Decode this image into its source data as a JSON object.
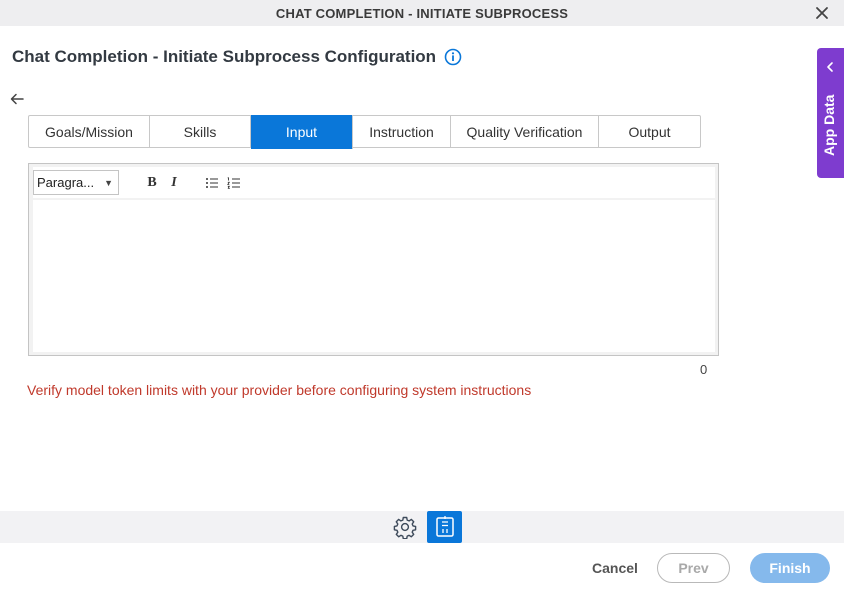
{
  "window": {
    "title": "CHAT COMPLETION - INITIATE SUBPROCESS",
    "close_icon": "close-icon"
  },
  "page": {
    "title": "Chat Completion - Initiate Subprocess Configuration",
    "info_icon": "info-icon",
    "back_icon": "arrow-left-icon"
  },
  "tabs": [
    {
      "label": "Goals/Mission",
      "active": false
    },
    {
      "label": "Skills",
      "active": false
    },
    {
      "label": "Input",
      "active": true
    },
    {
      "label": "Instruction",
      "active": false
    },
    {
      "label": "Quality Verification",
      "active": false
    },
    {
      "label": "Output",
      "active": false
    }
  ],
  "editor": {
    "format_value": "Paragra...",
    "bold_label": "B",
    "italic_label": "I",
    "bulleted_list_icon": "bulleted-list-icon",
    "numbered_list_icon": "numbered-list-icon",
    "content": "",
    "char_count": "0"
  },
  "warning": "Verify model token limits with your provider before configuring system instructions",
  "footer": {
    "gear_icon": "gear-icon",
    "doc_icon": "document-map-icon",
    "cancel_label": "Cancel",
    "prev_label": "Prev",
    "finish_label": "Finish"
  },
  "app_data": {
    "label": "App Data",
    "chevron_icon": "chevron-left-icon"
  },
  "colors": {
    "accent": "#0a77d9",
    "app_data_bg": "#7e3ccf",
    "warning": "#c0392b",
    "finish_bg": "#85b9ec"
  }
}
